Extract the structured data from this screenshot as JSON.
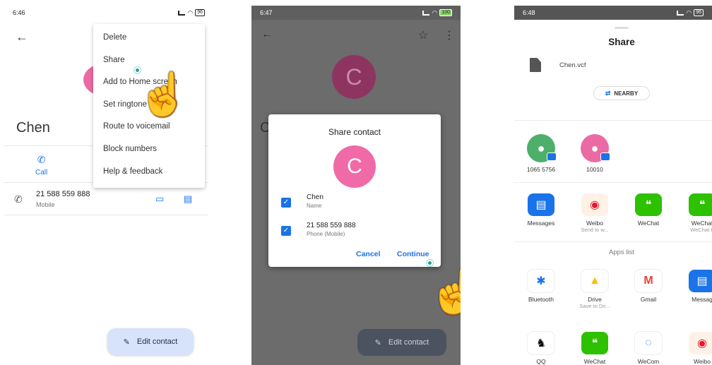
{
  "phone1": {
    "status": {
      "time": "6:46",
      "battery": "96"
    },
    "contact": {
      "name": "Chen"
    },
    "actions": {
      "call": "Call"
    },
    "phone": {
      "number": "21 588 559 888",
      "type": "Mobile"
    },
    "menu": [
      "Delete",
      "Share",
      "Add to Home screen",
      "Set ringtone",
      "Route to voicemail",
      "Block numbers",
      "Help & feedback"
    ],
    "fab": "Edit contact"
  },
  "phone2": {
    "status": {
      "time": "6:47",
      "battery": "100"
    },
    "avatar_letter": "C",
    "contact_initial_peek": "C",
    "dialog": {
      "title": "Share contact",
      "avatar_letter": "C",
      "rows": [
        {
          "value": "Chen",
          "type": "Name"
        },
        {
          "value": "21 588 559 888",
          "type": "Phone (Mobile)"
        }
      ],
      "cancel": "Cancel",
      "continue": "Continue"
    },
    "fab": "Edit contact"
  },
  "phone3": {
    "status": {
      "time": "6:48",
      "battery": "96"
    },
    "title": "Share",
    "file_name": "Chen.vcf",
    "nearby": "NEARBY",
    "contacts": [
      {
        "label": "1065 5756",
        "color": "#4caf6a"
      },
      {
        "label": "10010",
        "color": "#ec6aa4"
      }
    ],
    "direct_apps": [
      {
        "label": "Messages",
        "sub": "",
        "color": "#1a73e8",
        "icon": "messages-icon"
      },
      {
        "label": "Weibo",
        "sub": "Send to w...",
        "color": "#fff1e6",
        "icon": "weibo-icon"
      },
      {
        "label": "WeChat",
        "sub": "",
        "color": "#2dc100",
        "icon": "wechat-icon"
      },
      {
        "label": "WeChat",
        "sub": "WeChat F",
        "color": "#2dc100",
        "icon": "wechat-icon"
      }
    ],
    "apps_list_label": "Apps list",
    "apps": [
      {
        "label": "Bluetooth",
        "sub": "",
        "color": "#ffffff",
        "icon": "bluetooth-icon"
      },
      {
        "label": "Drive",
        "sub": "Save to Dri...",
        "color": "#ffffff",
        "icon": "drive-icon"
      },
      {
        "label": "Gmail",
        "sub": "",
        "color": "#ffffff",
        "icon": "gmail-icon"
      },
      {
        "label": "Messag",
        "sub": "",
        "color": "#1a73e8",
        "icon": "messages-icon"
      }
    ],
    "bottom_apps": [
      {
        "label": "QQ",
        "color": "#ffffff",
        "icon": "qq-icon"
      },
      {
        "label": "WeChat",
        "color": "#2dc100",
        "icon": "wechat-icon"
      },
      {
        "label": "WeCom",
        "color": "#ffffff",
        "icon": "wecom-icon"
      },
      {
        "label": "Weibo",
        "color": "#fff1e6",
        "icon": "weibo-icon"
      }
    ]
  }
}
